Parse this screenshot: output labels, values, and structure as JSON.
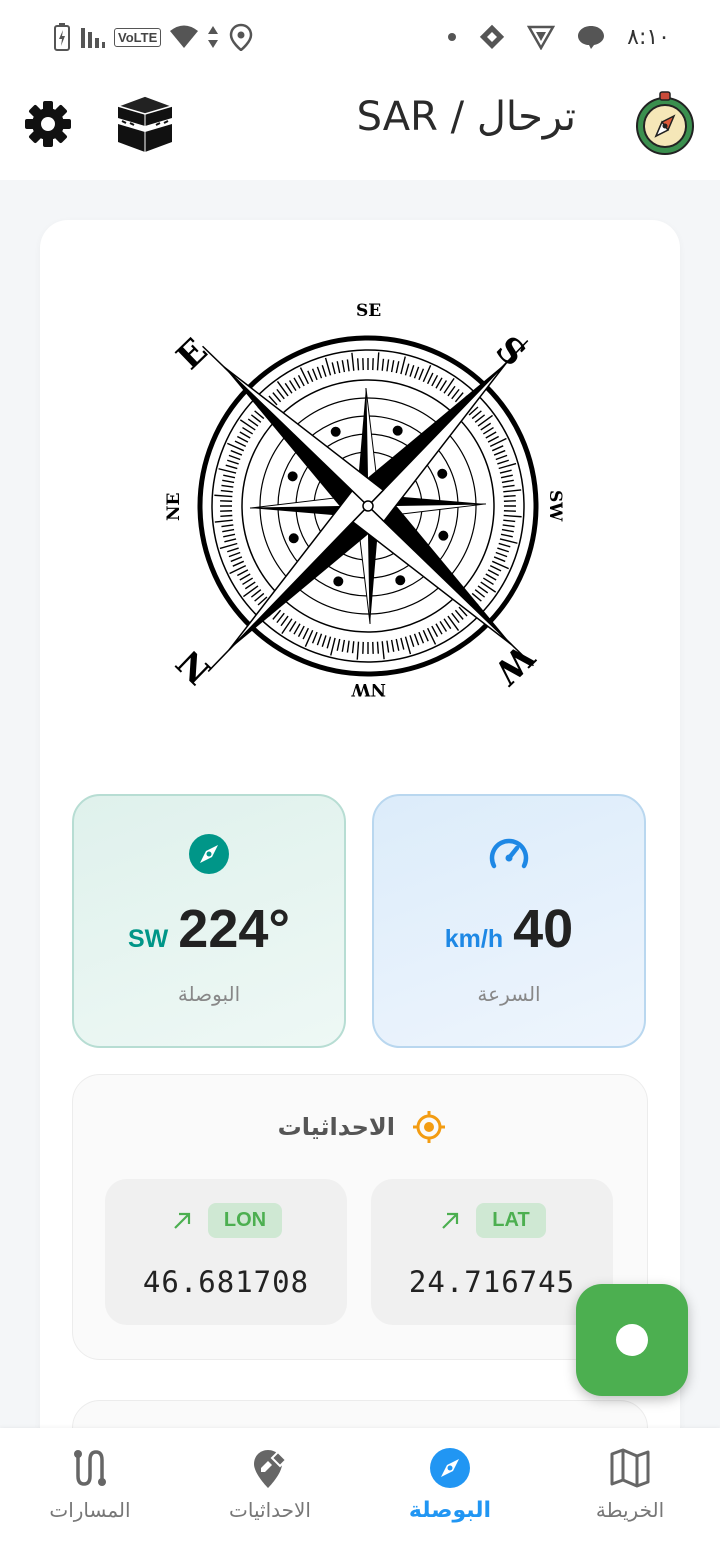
{
  "status_bar": {
    "time": "٨:١٠",
    "volte": "VoLTE"
  },
  "header": {
    "title": "SAR / ترحال",
    "settings_icon": "gear-icon",
    "qibla_icon": "kaaba-icon",
    "logo_icon": "compass-logo-icon"
  },
  "compass": {
    "labels": {
      "top": "SE",
      "top_left": "E",
      "top_right": "S",
      "left": "NE",
      "right": "SW",
      "bottom_left": "N",
      "bottom_right": "W",
      "bottom": "NW"
    }
  },
  "stats": {
    "compass": {
      "value": "224°",
      "unit": "SW",
      "label": "البوصلة",
      "color": "#009688"
    },
    "speed": {
      "value": "40",
      "unit": "km/h",
      "label": "السرعة",
      "color": "#1e88e5"
    }
  },
  "coordinates": {
    "title": "الاحداثيات",
    "lon": {
      "tag": "LON",
      "value": "46.681708"
    },
    "lat": {
      "tag": "LAT",
      "value": "24.716745"
    }
  },
  "bottom_nav": {
    "items": [
      {
        "label": "المسارات",
        "icon": "route-icon"
      },
      {
        "label": "الاحداثيات",
        "icon": "location-edit-icon"
      },
      {
        "label": "البوصلة",
        "icon": "compass-icon",
        "active": true
      },
      {
        "label": "الخريطة",
        "icon": "map-icon"
      }
    ]
  },
  "colors": {
    "accent_blue": "#2196f3",
    "accent_green": "#4caf50",
    "accent_teal": "#009688",
    "accent_orange": "#f39c12"
  }
}
